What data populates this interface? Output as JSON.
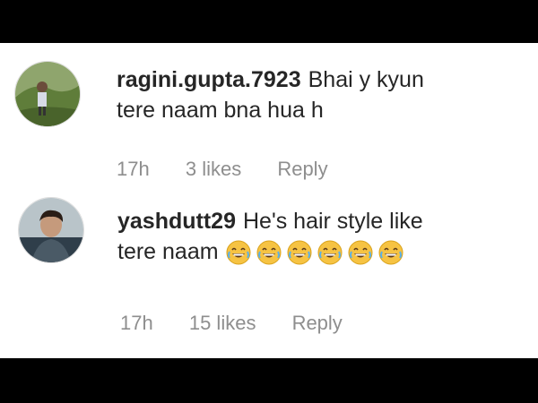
{
  "comments": [
    {
      "username": "ragini.gupta.7923",
      "text_line1": "Bhai y kyun",
      "text_line2": "tere naam bna hua h",
      "time": "17h",
      "likes": "3 likes",
      "reply": "Reply",
      "avatar_icon": "avatar-outdoor-person"
    },
    {
      "username": "yashdutt29",
      "text_line1": "He's hair style like",
      "text_line2": "tere naam",
      "emoji_count": 6,
      "emoji_icon": "grinning-face-with-tears-emoji",
      "time": "17h",
      "likes": "15 likes",
      "reply": "Reply",
      "avatar_icon": "avatar-person-portrait"
    }
  ]
}
